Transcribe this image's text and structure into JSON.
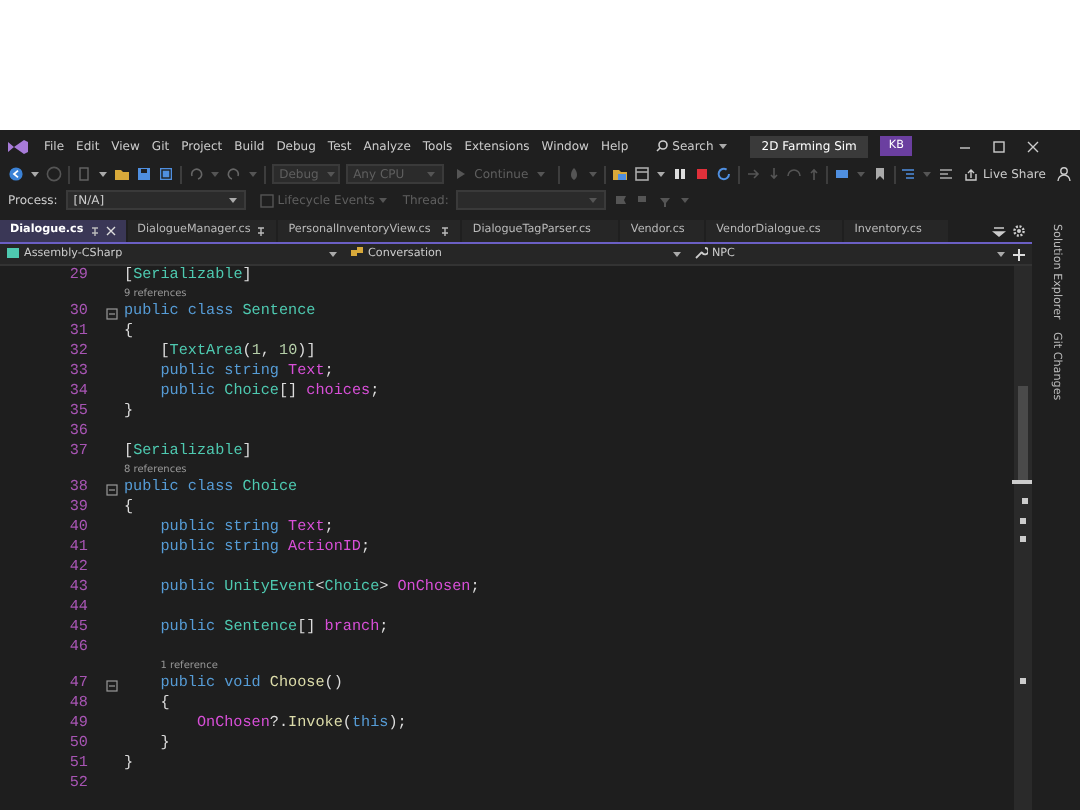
{
  "menu": {
    "items": [
      "File",
      "Edit",
      "View",
      "Git",
      "Project",
      "Build",
      "Debug",
      "Test",
      "Analyze",
      "Tools",
      "Extensions",
      "Window",
      "Help"
    ],
    "search": "Search",
    "solution": "2D Farming Sim",
    "account": "KB"
  },
  "toolbar": {
    "configuration": {
      "label": "Debug",
      "disabled": true
    },
    "platform": {
      "label": "Any CPU",
      "disabled": true
    },
    "continue": {
      "label": "Continue",
      "disabled": true
    },
    "live_share": "Live Share"
  },
  "debug_location": {
    "process_label": "Process:",
    "process": "[N/A]",
    "lifecycle": {
      "label": "Lifecycle Events",
      "disabled": true
    },
    "thread": {
      "label": "Thread:",
      "disabled": true
    }
  },
  "tabs": [
    {
      "label": "Dialogue.cs",
      "selected": true,
      "pinned": true
    },
    {
      "label": "DialogueManager.cs",
      "selected": false,
      "pinned": true
    },
    {
      "label": "PersonalInventoryView.cs",
      "selected": false,
      "pinned": true
    },
    {
      "label": "DialogueTagParser.cs",
      "selected": false,
      "pinned": false
    },
    {
      "label": "Vendor.cs",
      "selected": false,
      "pinned": false
    },
    {
      "label": "VendorDialogue.cs",
      "selected": false,
      "pinned": false
    },
    {
      "label": "Inventory.cs",
      "selected": false,
      "pinned": false
    }
  ],
  "navigation": {
    "project": "Assembly-CSharp",
    "type": "Conversation",
    "member": "NPC"
  },
  "code": {
    "lines": [
      {
        "number": "29",
        "fold": false,
        "tokens": [
          {
            "text": "[",
            "kind": "plain"
          },
          {
            "text": "Serializable",
            "kind": "type"
          },
          {
            "text": "]",
            "kind": "plain"
          }
        ]
      },
      {
        "number": "30",
        "fold": true,
        "lens": "9 references",
        "tokens": [
          {
            "text": "public class ",
            "kind": "keyword"
          },
          {
            "text": "Sentence",
            "kind": "type"
          }
        ]
      },
      {
        "number": "31",
        "fold": false,
        "tokens": [
          {
            "text": "{",
            "kind": "plain"
          }
        ]
      },
      {
        "number": "32",
        "fold": false,
        "tokens": [
          {
            "text": "    [",
            "kind": "plain"
          },
          {
            "text": "TextArea",
            "kind": "type"
          },
          {
            "text": "(",
            "kind": "plain"
          },
          {
            "text": "1",
            "kind": "number"
          },
          {
            "text": ", ",
            "kind": "plain"
          },
          {
            "text": "10",
            "kind": "number"
          },
          {
            "text": ")]",
            "kind": "plain"
          }
        ]
      },
      {
        "number": "33",
        "fold": false,
        "tokens": [
          {
            "text": "    public string ",
            "kind": "keyword"
          },
          {
            "text": "Text",
            "kind": "field"
          },
          {
            "text": ";",
            "kind": "plain"
          }
        ]
      },
      {
        "number": "34",
        "fold": false,
        "tokens": [
          {
            "text": "    public ",
            "kind": "keyword"
          },
          {
            "text": "Choice",
            "kind": "type"
          },
          {
            "text": "[] ",
            "kind": "plain"
          },
          {
            "text": "choices",
            "kind": "field"
          },
          {
            "text": ";",
            "kind": "plain"
          }
        ]
      },
      {
        "number": "35",
        "fold": false,
        "tokens": [
          {
            "text": "}",
            "kind": "plain"
          }
        ]
      },
      {
        "number": "36",
        "fold": false
      },
      {
        "number": "37",
        "fold": false,
        "tokens": [
          {
            "text": "[",
            "kind": "plain"
          },
          {
            "text": "Serializable",
            "kind": "type"
          },
          {
            "text": "]",
            "kind": "plain"
          }
        ]
      },
      {
        "number": "38",
        "fold": true,
        "lens": "8 references",
        "tokens": [
          {
            "text": "public class ",
            "kind": "keyword"
          },
          {
            "text": "Choice",
            "kind": "type"
          }
        ]
      },
      {
        "number": "39",
        "fold": false,
        "tokens": [
          {
            "text": "{",
            "kind": "plain"
          }
        ]
      },
      {
        "number": "40",
        "fold": false,
        "tokens": [
          {
            "text": "    public string ",
            "kind": "keyword"
          },
          {
            "text": "Text",
            "kind": "field"
          },
          {
            "text": ";",
            "kind": "plain"
          }
        ]
      },
      {
        "number": "41",
        "fold": false,
        "tokens": [
          {
            "text": "    public string ",
            "kind": "keyword"
          },
          {
            "text": "ActionID",
            "kind": "field"
          },
          {
            "text": ";",
            "kind": "plain"
          }
        ]
      },
      {
        "number": "42",
        "fold": false
      },
      {
        "number": "43",
        "fold": false,
        "tokens": [
          {
            "text": "    public ",
            "kind": "keyword"
          },
          {
            "text": "UnityEvent",
            "kind": "type"
          },
          {
            "text": "<",
            "kind": "plain"
          },
          {
            "text": "Choice",
            "kind": "type"
          },
          {
            "text": "> ",
            "kind": "plain"
          },
          {
            "text": "OnChosen",
            "kind": "field"
          },
          {
            "text": ";",
            "kind": "plain"
          }
        ]
      },
      {
        "number": "44",
        "fold": false
      },
      {
        "number": "45",
        "fold": false,
        "tokens": [
          {
            "text": "    public ",
            "kind": "keyword"
          },
          {
            "text": "Sentence",
            "kind": "type"
          },
          {
            "text": "[] ",
            "kind": "plain"
          },
          {
            "text": "branch",
            "kind": "field"
          },
          {
            "text": ";",
            "kind": "plain"
          }
        ]
      },
      {
        "number": "46",
        "fold": false
      },
      {
        "number": "47",
        "fold": true,
        "lens": "1 reference",
        "tokens": [
          {
            "text": "    public void ",
            "kind": "keyword"
          },
          {
            "text": "Choose",
            "kind": "method"
          },
          {
            "text": "()",
            "kind": "plain"
          }
        ]
      },
      {
        "number": "48",
        "fold": false,
        "tokens": [
          {
            "text": "    {",
            "kind": "plain"
          }
        ]
      },
      {
        "number": "49",
        "fold": false,
        "tokens": [
          {
            "text": "        OnChosen",
            "kind": "field"
          },
          {
            "text": "?.",
            "kind": "plain"
          },
          {
            "text": "Invoke",
            "kind": "method"
          },
          {
            "text": "(",
            "kind": "plain"
          },
          {
            "text": "this",
            "kind": "keyword"
          },
          {
            "text": ");",
            "kind": "plain"
          }
        ]
      },
      {
        "number": "50",
        "fold": false,
        "tokens": [
          {
            "text": "    }",
            "kind": "plain"
          }
        ]
      },
      {
        "number": "51",
        "fold": false,
        "tokens": [
          {
            "text": "}",
            "kind": "plain"
          }
        ]
      },
      {
        "number": "52",
        "fold": false
      }
    ]
  },
  "side_tabs": [
    "Solution Explorer",
    "Git Changes"
  ]
}
